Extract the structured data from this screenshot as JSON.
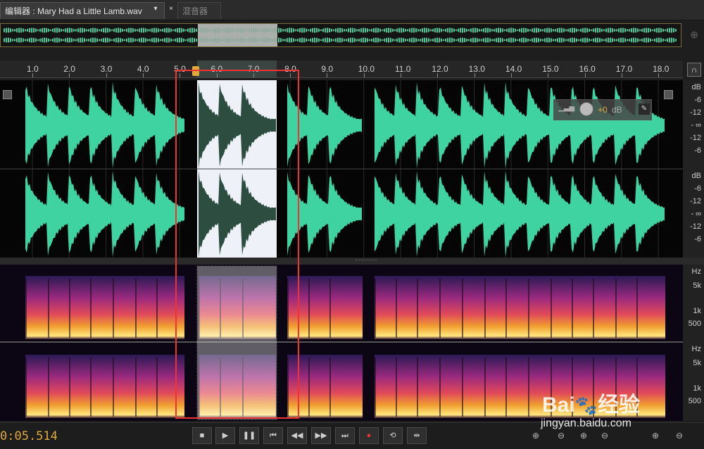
{
  "tabs": {
    "editor_label": "编辑器 : Mary Had a Little Lamb.wav",
    "dropdown_glyph": "▾",
    "close_glyph": "×",
    "mixer_label": "混音器"
  },
  "ruler": {
    "units": "hms",
    "ticks": [
      "1.0",
      "2.0",
      "3.0",
      "4.0",
      "5.0",
      "6.0",
      "7.0",
      "8.0",
      "9.0",
      "10.0",
      "11.0",
      "12.0",
      "13.0",
      "14.0",
      "15.0",
      "16.0",
      "17.0",
      "18.0"
    ]
  },
  "db_scale": [
    "dB",
    "-6",
    "-12",
    "- ∞",
    "-12",
    "-6"
  ],
  "hz_scale": [
    "Hz",
    "5k",
    "1k",
    "500"
  ],
  "hud": {
    "gain": "+0",
    "unit": "dB"
  },
  "transport": {
    "timecode": "0:05.514",
    "buttons": [
      "stop-icon",
      "play-icon",
      "pause-icon",
      "skip-start-icon",
      "rewind-icon",
      "fast-forward-icon",
      "skip-end-icon",
      "record-icon",
      "loop-icon",
      "skip-selection-icon"
    ]
  },
  "colors": {
    "waveform": "#3fd3a2",
    "waveform_selected": "#2c4d3f",
    "selection_bg": "#eef2f8",
    "timecode": "#e0a93a",
    "highlight_box": "#e33333"
  },
  "watermark": {
    "brand": "Bai",
    "brand_suffix": "经验",
    "url": "jingyan.baidu.com"
  }
}
